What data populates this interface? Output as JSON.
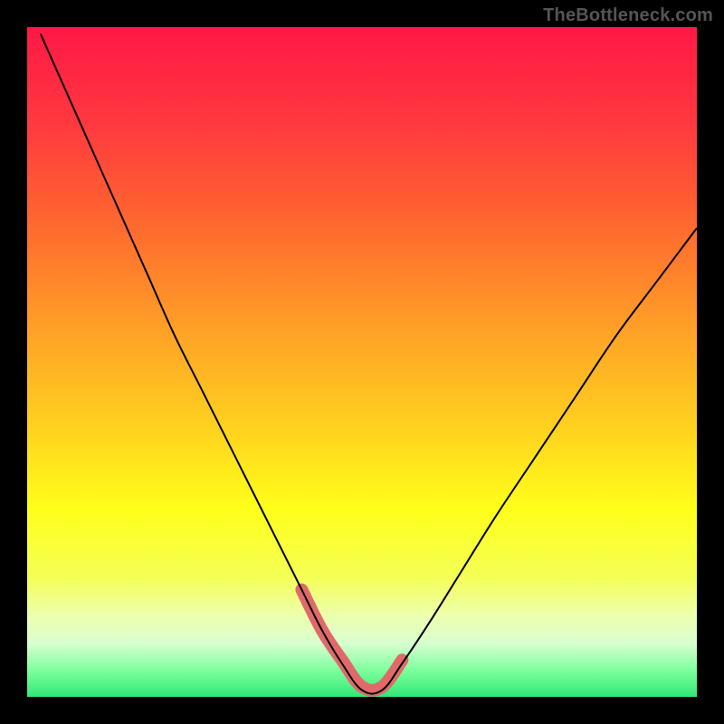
{
  "watermark": "TheBottleneck.com",
  "chart_data": {
    "type": "line",
    "title": "",
    "xlabel": "",
    "ylabel": "",
    "xlim": [
      0,
      100
    ],
    "ylim": [
      0,
      100
    ],
    "grid": false,
    "axes_visible": false,
    "legend": false,
    "background_gradient_stops": [
      {
        "offset": 0.0,
        "color": "#ff1846"
      },
      {
        "offset": 0.15,
        "color": "#ff3a3f"
      },
      {
        "offset": 0.3,
        "color": "#ff6a2e"
      },
      {
        "offset": 0.45,
        "color": "#ffa027"
      },
      {
        "offset": 0.6,
        "color": "#ffd21f"
      },
      {
        "offset": 0.72,
        "color": "#ffff1a"
      },
      {
        "offset": 0.82,
        "color": "#f4ff55"
      },
      {
        "offset": 0.88,
        "color": "#ecffb0"
      },
      {
        "offset": 0.92,
        "color": "#d8ffd0"
      },
      {
        "offset": 0.96,
        "color": "#7eff9d"
      },
      {
        "offset": 1.0,
        "color": "#30e876"
      }
    ],
    "inner_border_px": 30,
    "series": [
      {
        "name": "bottleneck-curve",
        "stroke": "#000000",
        "stroke_width": 2,
        "x": [
          2,
          6,
          10,
          14,
          18,
          22,
          26,
          30,
          34,
          38,
          41,
          44,
          47,
          50,
          53,
          56,
          60,
          65,
          70,
          76,
          82,
          88,
          94,
          100
        ],
        "y": [
          99,
          90,
          81,
          72,
          63,
          54,
          46,
          38,
          30,
          22,
          16,
          10,
          5,
          1,
          1,
          5,
          11,
          19,
          27,
          36,
          45,
          54,
          62,
          70
        ]
      }
    ],
    "highlight": {
      "name": "valley-highlight",
      "stroke": "#e06a6a",
      "stroke_width": 14,
      "linecap": "round",
      "x": [
        41,
        44,
        47,
        50,
        53,
        56
      ],
      "y": [
        16,
        10,
        5.5,
        1.5,
        1.5,
        5.5
      ]
    }
  }
}
